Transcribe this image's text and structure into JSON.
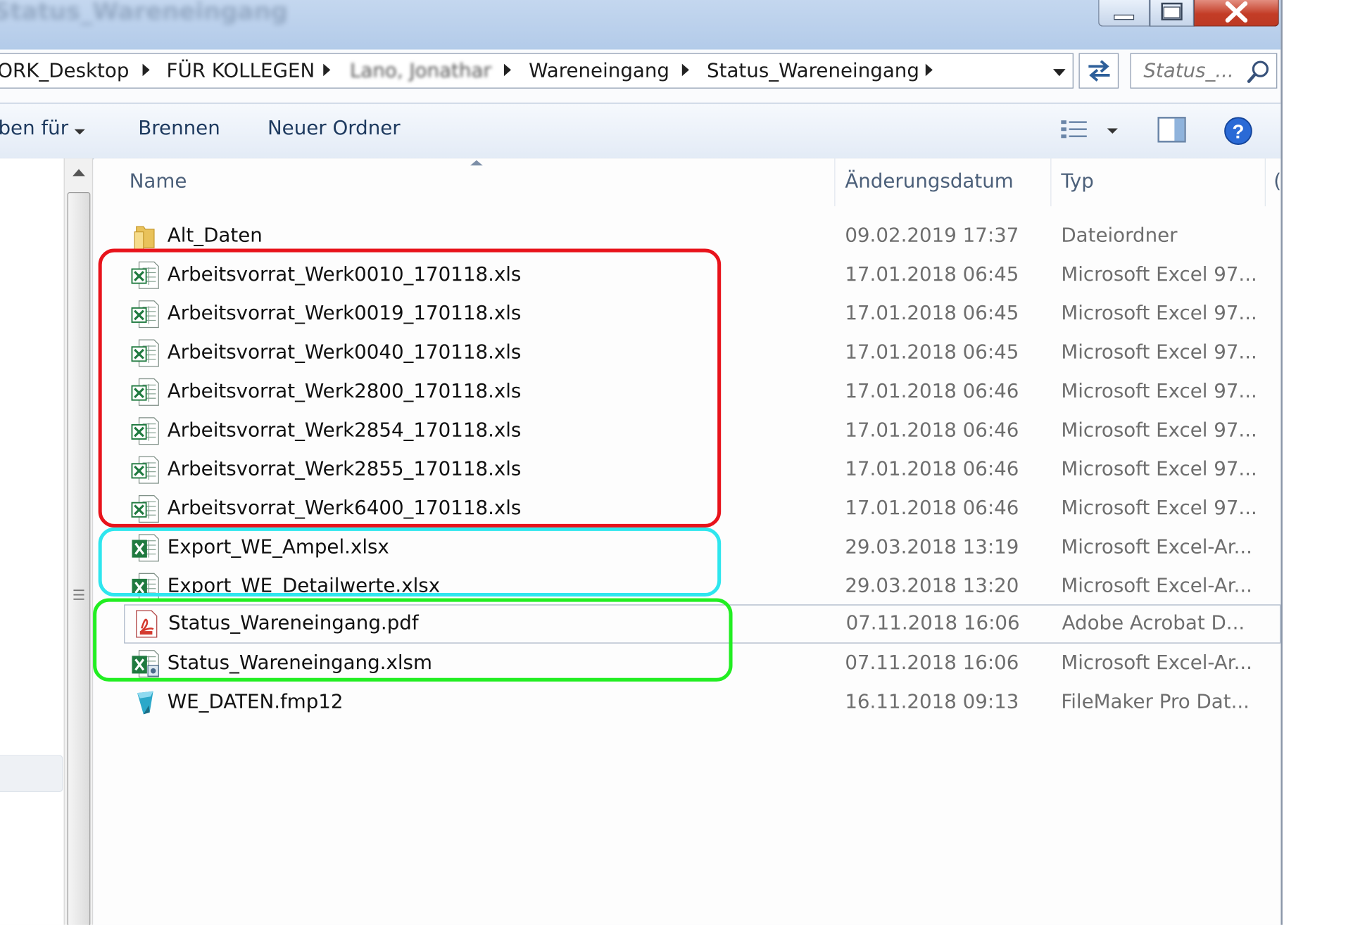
{
  "window": {
    "title": "Status_Wareneingang"
  },
  "address_bar": {
    "crumbs": [
      "ORK_Desktop",
      "FÜR KOLLEGEN",
      "Lano, Jonathan",
      "Wareneingang",
      "Status_Wareneingang"
    ]
  },
  "search": {
    "placeholder": "Status_..."
  },
  "toolbar": {
    "share_label": "ben für",
    "burn_label": "Brennen",
    "new_folder_label": "Neuer Ordner"
  },
  "columns": {
    "name": "Name",
    "date": "Änderungsdatum",
    "type": "Typ"
  },
  "files": [
    {
      "name": "Alt_Daten",
      "date": "09.02.2019 17:37",
      "type": "Dateiordner",
      "icon": "folder-icon"
    },
    {
      "name": "Arbeitsvorrat_Werk0010_170118.xls",
      "date": "17.01.2018 06:45",
      "type": "Microsoft Excel 97...",
      "icon": "excel-97-icon"
    },
    {
      "name": "Arbeitsvorrat_Werk0019_170118.xls",
      "date": "17.01.2018 06:45",
      "type": "Microsoft Excel 97...",
      "icon": "excel-97-icon"
    },
    {
      "name": "Arbeitsvorrat_Werk0040_170118.xls",
      "date": "17.01.2018 06:45",
      "type": "Microsoft Excel 97...",
      "icon": "excel-97-icon"
    },
    {
      "name": "Arbeitsvorrat_Werk2800_170118.xls",
      "date": "17.01.2018 06:46",
      "type": "Microsoft Excel 97...",
      "icon": "excel-97-icon"
    },
    {
      "name": "Arbeitsvorrat_Werk2854_170118.xls",
      "date": "17.01.2018 06:46",
      "type": "Microsoft Excel 97...",
      "icon": "excel-97-icon"
    },
    {
      "name": "Arbeitsvorrat_Werk2855_170118.xls",
      "date": "17.01.2018 06:46",
      "type": "Microsoft Excel 97...",
      "icon": "excel-97-icon"
    },
    {
      "name": "Arbeitsvorrat_Werk6400_170118.xls",
      "date": "17.01.2018 06:46",
      "type": "Microsoft Excel 97...",
      "icon": "excel-97-icon"
    },
    {
      "name": "Export_WE_Ampel.xlsx",
      "date": "29.03.2018 13:19",
      "type": "Microsoft Excel-Ar...",
      "icon": "excel-xlsx-icon"
    },
    {
      "name": "Export_WE_Detailwerte.xlsx",
      "date": "29.03.2018 13:20",
      "type": "Microsoft Excel-Ar...",
      "icon": "excel-xlsx-icon"
    },
    {
      "name": "Status_Wareneingang.pdf",
      "date": "07.11.2018 16:06",
      "type": "Adobe Acrobat D...",
      "icon": "pdf-icon"
    },
    {
      "name": "Status_Wareneingang.xlsm",
      "date": "07.11.2018 16:06",
      "type": "Microsoft Excel-Ar...",
      "icon": "excel-xlsm-icon"
    },
    {
      "name": "WE_DATEN.fmp12",
      "date": "16.11.2018 09:13",
      "type": "FileMaker Pro Dat...",
      "icon": "filemaker-icon"
    }
  ],
  "annotation_colors": {
    "red_box": "#e8131b",
    "cyan_box": "#2ee6ee",
    "green_box": "#22ee22"
  },
  "colors": {
    "titlebar": "#b9cfec",
    "close_button": "#c9442e",
    "help_icon": "#2a6ad6",
    "excel_green": "#1f7a3f",
    "folder_yellow": "#e9c25a"
  }
}
